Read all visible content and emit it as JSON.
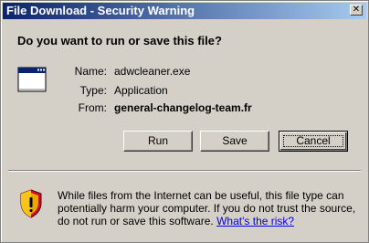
{
  "window": {
    "title": "File Download - Security Warning",
    "close_glyph": "✕"
  },
  "question": "Do you want to run or save this file?",
  "file": {
    "name_label": "Name:",
    "name_value": "adwcleaner.exe",
    "type_label": "Type:",
    "type_value": "Application",
    "from_label": "From:",
    "from_value": "general-changelog-team.fr"
  },
  "buttons": {
    "run_label": "Run",
    "save_label": "Save",
    "cancel_label": "Cancel"
  },
  "warning": {
    "text": "While files from the Internet can be useful, this file type can potentially harm your computer. If you do not trust the source, do not run or save this software.",
    "link_text": "What's the risk?"
  },
  "icons": {
    "app": "application-window-icon",
    "shield": "security-shield-icon",
    "close": "close-icon"
  },
  "colors": {
    "titlebar_start": "#0a246a",
    "titlebar_end": "#a6caf0",
    "dialog_bg": "#d4d0c8",
    "link": "#0000ee",
    "shield_yellow": "#f5c518",
    "shield_red": "#c8102e"
  }
}
